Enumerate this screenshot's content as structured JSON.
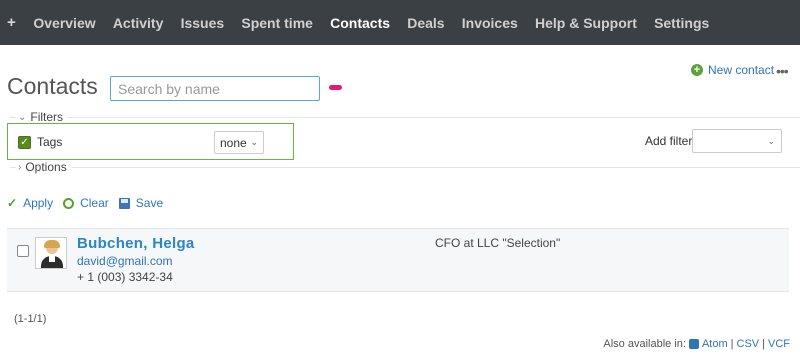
{
  "menu": {
    "plus": "+",
    "items": [
      "Overview",
      "Activity",
      "Issues",
      "Spent time",
      "Contacts",
      "Deals",
      "Invoices",
      "Help & Support",
      "Settings"
    ],
    "active": "Contacts"
  },
  "page": {
    "title": "Contacts",
    "search_placeholder": "Search by name",
    "new_contact": "New contact",
    "more": "•••"
  },
  "filters": {
    "legend": "Filters",
    "tag_filter": {
      "label": "Tags",
      "checked": true,
      "operator": "none"
    },
    "add_filter_label": "Add filter",
    "add_filter_value": "",
    "options_legend": "Options"
  },
  "actions": {
    "apply": "Apply",
    "clear": "Clear",
    "save": "Save"
  },
  "contacts": [
    {
      "name": "Bubchen, Helga",
      "email": "david@gmail.com",
      "phone": "+ 1 (003) 3342-34",
      "job": "CFO at LLC \"Selection\""
    }
  ],
  "pagination": "(1-1/1)",
  "footer": {
    "also_available": "Also available in:",
    "formats": [
      "Atom",
      "CSV",
      "VCF"
    ]
  },
  "colors": {
    "menu_bg": "#3b4044",
    "link": "#2f75b5",
    "accent_pink": "#e0197b",
    "filter_border": "#6db447"
  }
}
